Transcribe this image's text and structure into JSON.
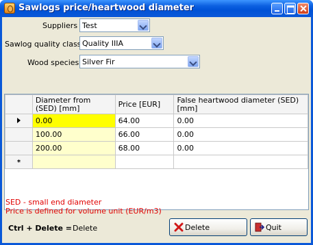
{
  "window": {
    "title": "Sawlogs price/heartwood diameter"
  },
  "form": {
    "suppliers": {
      "label": "Suppliers",
      "value": "Test"
    },
    "quality": {
      "label": "Sawlog quality class",
      "value": "Quality IIIA"
    },
    "species": {
      "label": "Wood species",
      "value": "Silver Fir"
    }
  },
  "grid": {
    "columns": [
      "Diameter from (SED) [mm]",
      "Price [EUR]",
      "False heartwood diameter (SED) [mm]"
    ],
    "rows": [
      [
        "0.00",
        "64.00",
        "0.00"
      ],
      [
        "100.00",
        "66.00",
        "0.00"
      ],
      [
        "200.00",
        "68.00",
        "0.00"
      ]
    ],
    "new_row_marker": "*"
  },
  "notes": {
    "sed": "SED - small end diameter",
    "price": "Price is defined for volume unit (EUR/m3)"
  },
  "shortcut": {
    "keys": "Ctrl + Delete =",
    "action": "Delete"
  },
  "buttons": {
    "delete": "Delete",
    "quit": "Quit"
  },
  "colors": {
    "active_cell": "#ffff00",
    "editable_cell": "#ffffcc",
    "note_text": "#e00000",
    "title_bar": "#0a58d8"
  },
  "icons": {
    "app": "sawlog-icon",
    "delete": "red-x-icon",
    "quit": "exit-door-icon"
  }
}
